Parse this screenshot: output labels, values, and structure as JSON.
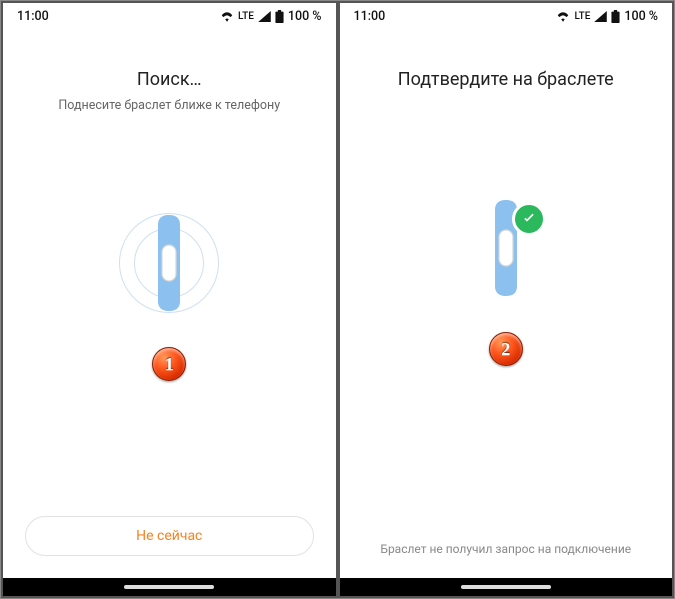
{
  "statusbar": {
    "time": "11:00",
    "network": "LTE",
    "battery": "100 %"
  },
  "left": {
    "title": "Поиск…",
    "subtitle": "Поднесите браслет ближе к телефону",
    "step": "1",
    "button": "Не сейчас"
  },
  "right": {
    "title": "Подтвердите на браслете",
    "step": "2",
    "bottom_text": "Браслет не получил запрос на подключение"
  },
  "colors": {
    "accent": "#f58220",
    "band": "#8cc0ef",
    "success": "#2cb85c"
  }
}
